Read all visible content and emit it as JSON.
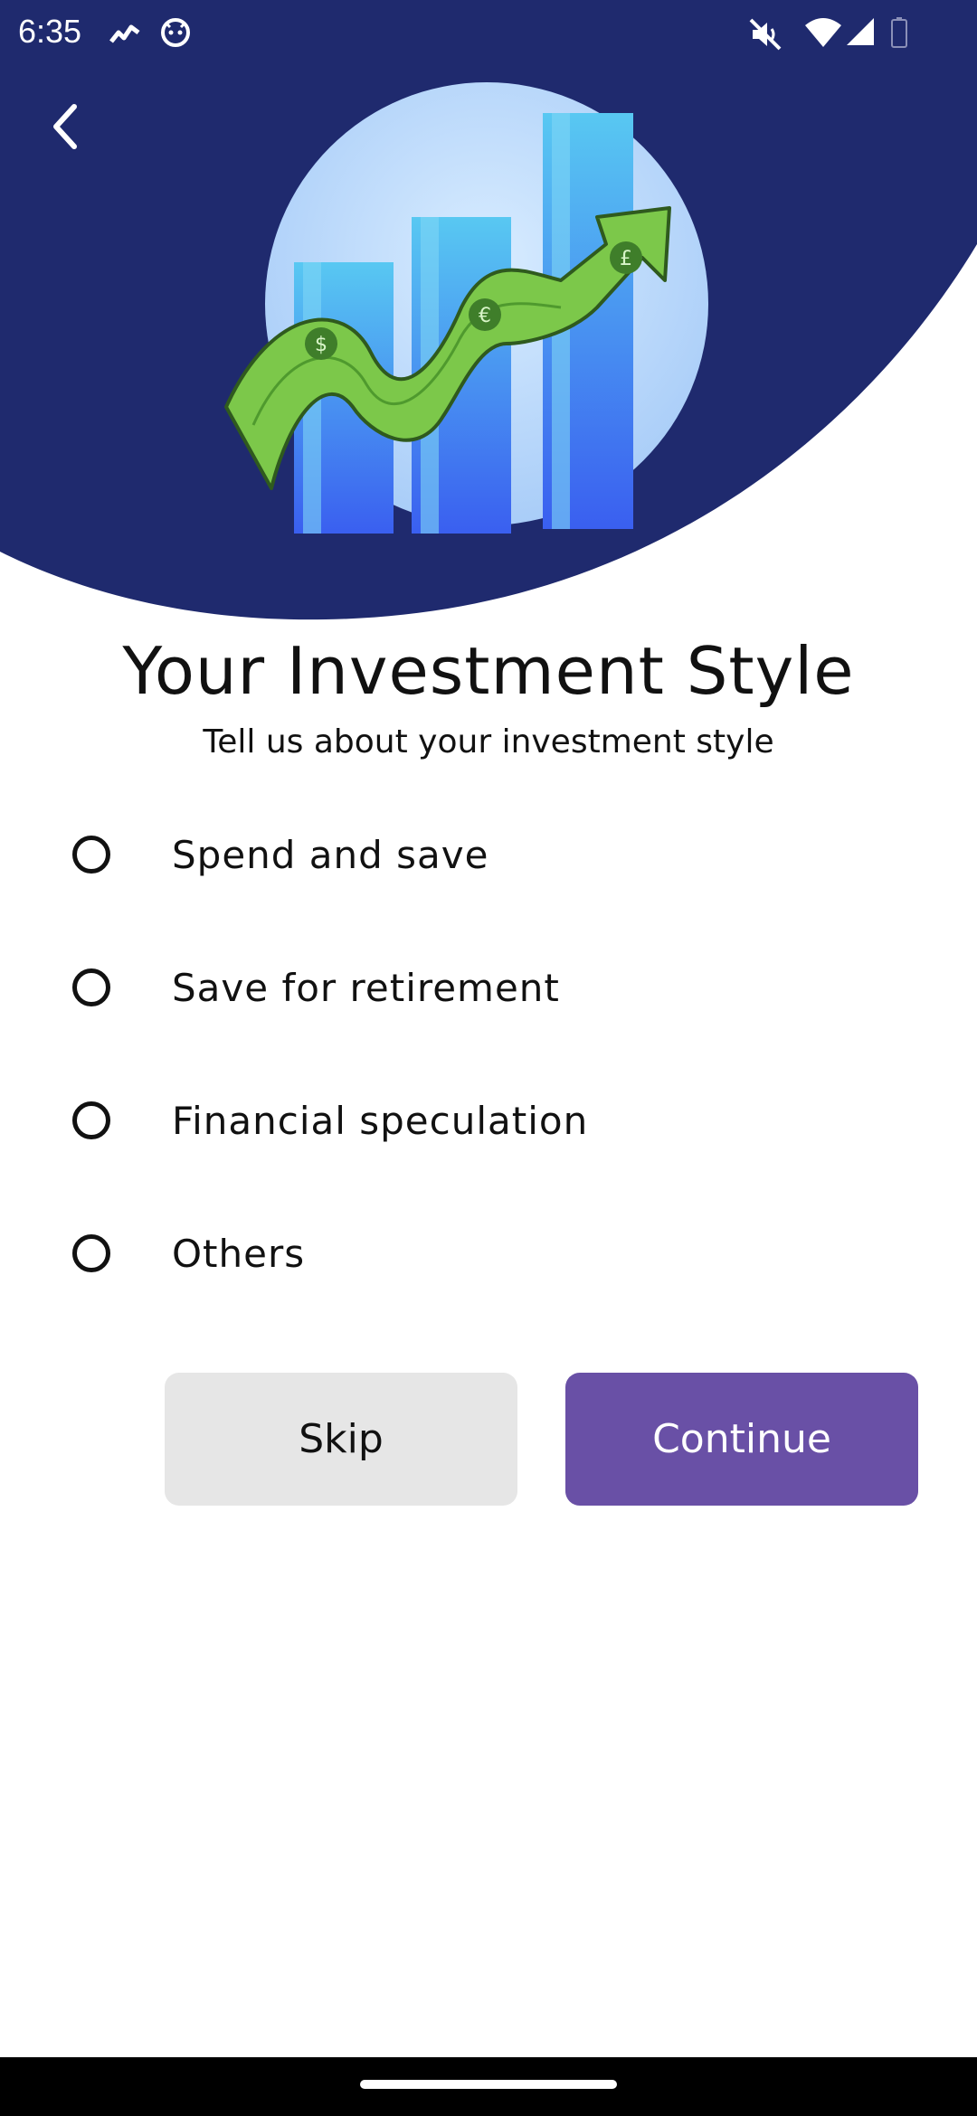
{
  "status_bar": {
    "time": "6:35",
    "icons": [
      "chart-app-icon",
      "cat-app-icon",
      "mute-icon",
      "wifi-icon",
      "signal-icon",
      "battery-icon"
    ]
  },
  "header": {
    "back_icon": "chevron-left-icon",
    "illustration": "investment-growth-illustration",
    "colors": {
      "background": "#1f2a6e"
    }
  },
  "main": {
    "title": "Your Investment Style",
    "subtitle": "Tell us about your investment style",
    "options": [
      {
        "label": "Spend and save",
        "selected": false
      },
      {
        "label": "Save for retirement",
        "selected": false
      },
      {
        "label": "Financial speculation",
        "selected": false
      },
      {
        "label": "Others",
        "selected": false
      }
    ]
  },
  "actions": {
    "skip_label": "Skip",
    "continue_label": "Continue",
    "colors": {
      "continue": "#6950a6",
      "skip": "#e6e6e6"
    }
  }
}
